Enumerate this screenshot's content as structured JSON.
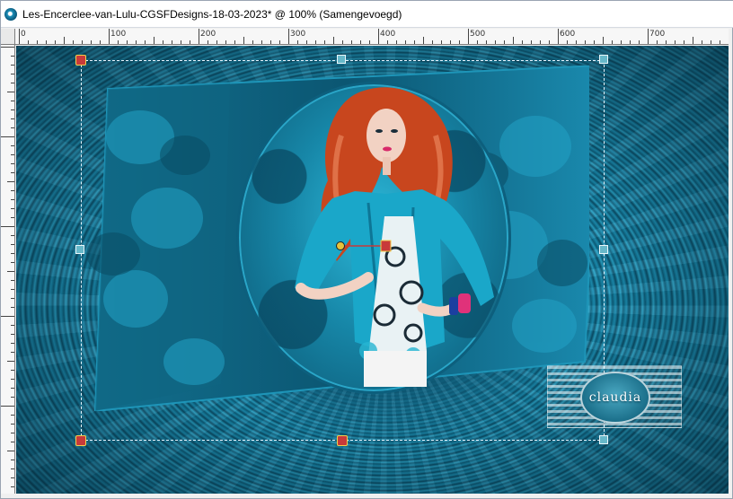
{
  "window": {
    "title": "Les-Encerclee-van-Lulu-CGSFDesigns-18-03-2023* @ 100% (Samengevoegd)",
    "icon": "psp-document-icon"
  },
  "ruler": {
    "labels": [
      "0",
      "100",
      "200",
      "300",
      "400",
      "500",
      "600",
      "700"
    ]
  },
  "canvas": {
    "watermark_text": "claudia",
    "colors": {
      "teal_dark": "#0b5571",
      "teal_mid": "#1787a8",
      "teal_light": "#2db8d8",
      "hair": "#c8461e",
      "jacket": "#1aa7c9",
      "handle_rot": "#c83a3a"
    }
  }
}
